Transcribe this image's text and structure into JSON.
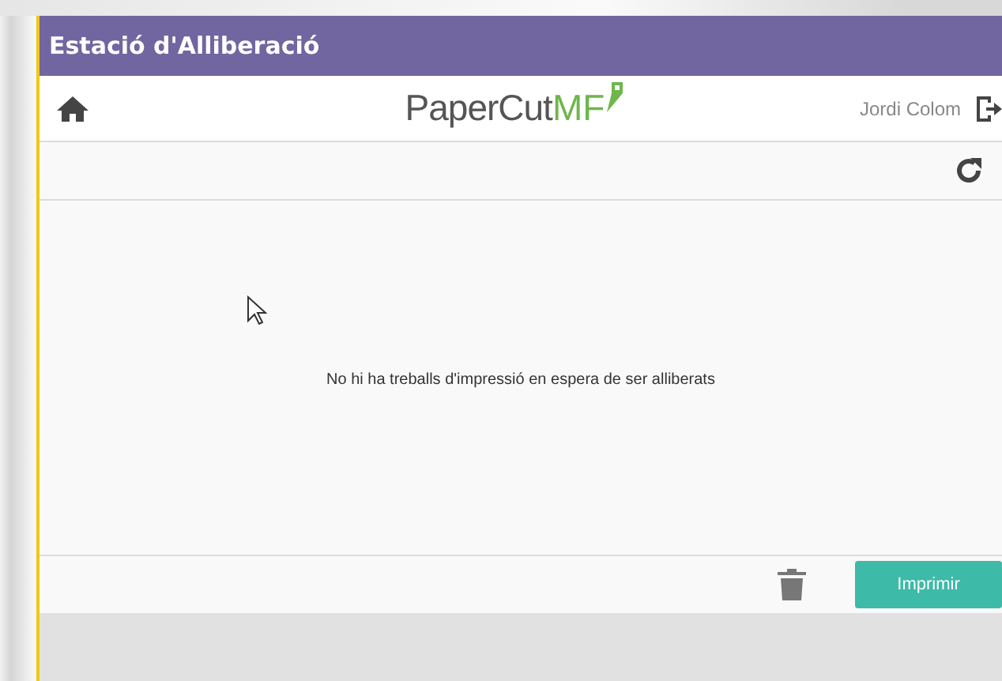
{
  "window": {
    "title": "Estació d'Alliberació"
  },
  "header": {
    "logo": {
      "brand": "PaperCut",
      "suffix": "MF"
    },
    "user": "Jordi Colom"
  },
  "content": {
    "message": "No hi ha treballs d'impressió en espera de ser alliberats"
  },
  "footer": {
    "print_button": "Imprimir"
  }
}
